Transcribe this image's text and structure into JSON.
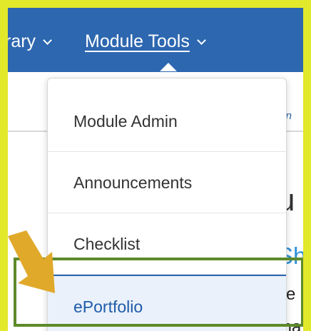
{
  "navbar": {
    "items": [
      {
        "label": "rary",
        "active": false
      },
      {
        "label": "Module Tools",
        "active": true
      }
    ]
  },
  "background": {
    "settings_link": "ttin",
    "heading": "u",
    "link": "Sh",
    "text_line1": "se",
    "text_line2": "ma"
  },
  "dropdown": {
    "items": [
      {
        "label": "Module Admin"
      },
      {
        "label": "Announcements"
      },
      {
        "label": "Checklist"
      },
      {
        "label": "ePortfolio",
        "selected": true
      }
    ]
  },
  "colors": {
    "frame_background": "#e2e82a",
    "navbar": "#2d67b0",
    "highlight_box": "#5d8a2b",
    "arrow": "#e0a92a"
  }
}
